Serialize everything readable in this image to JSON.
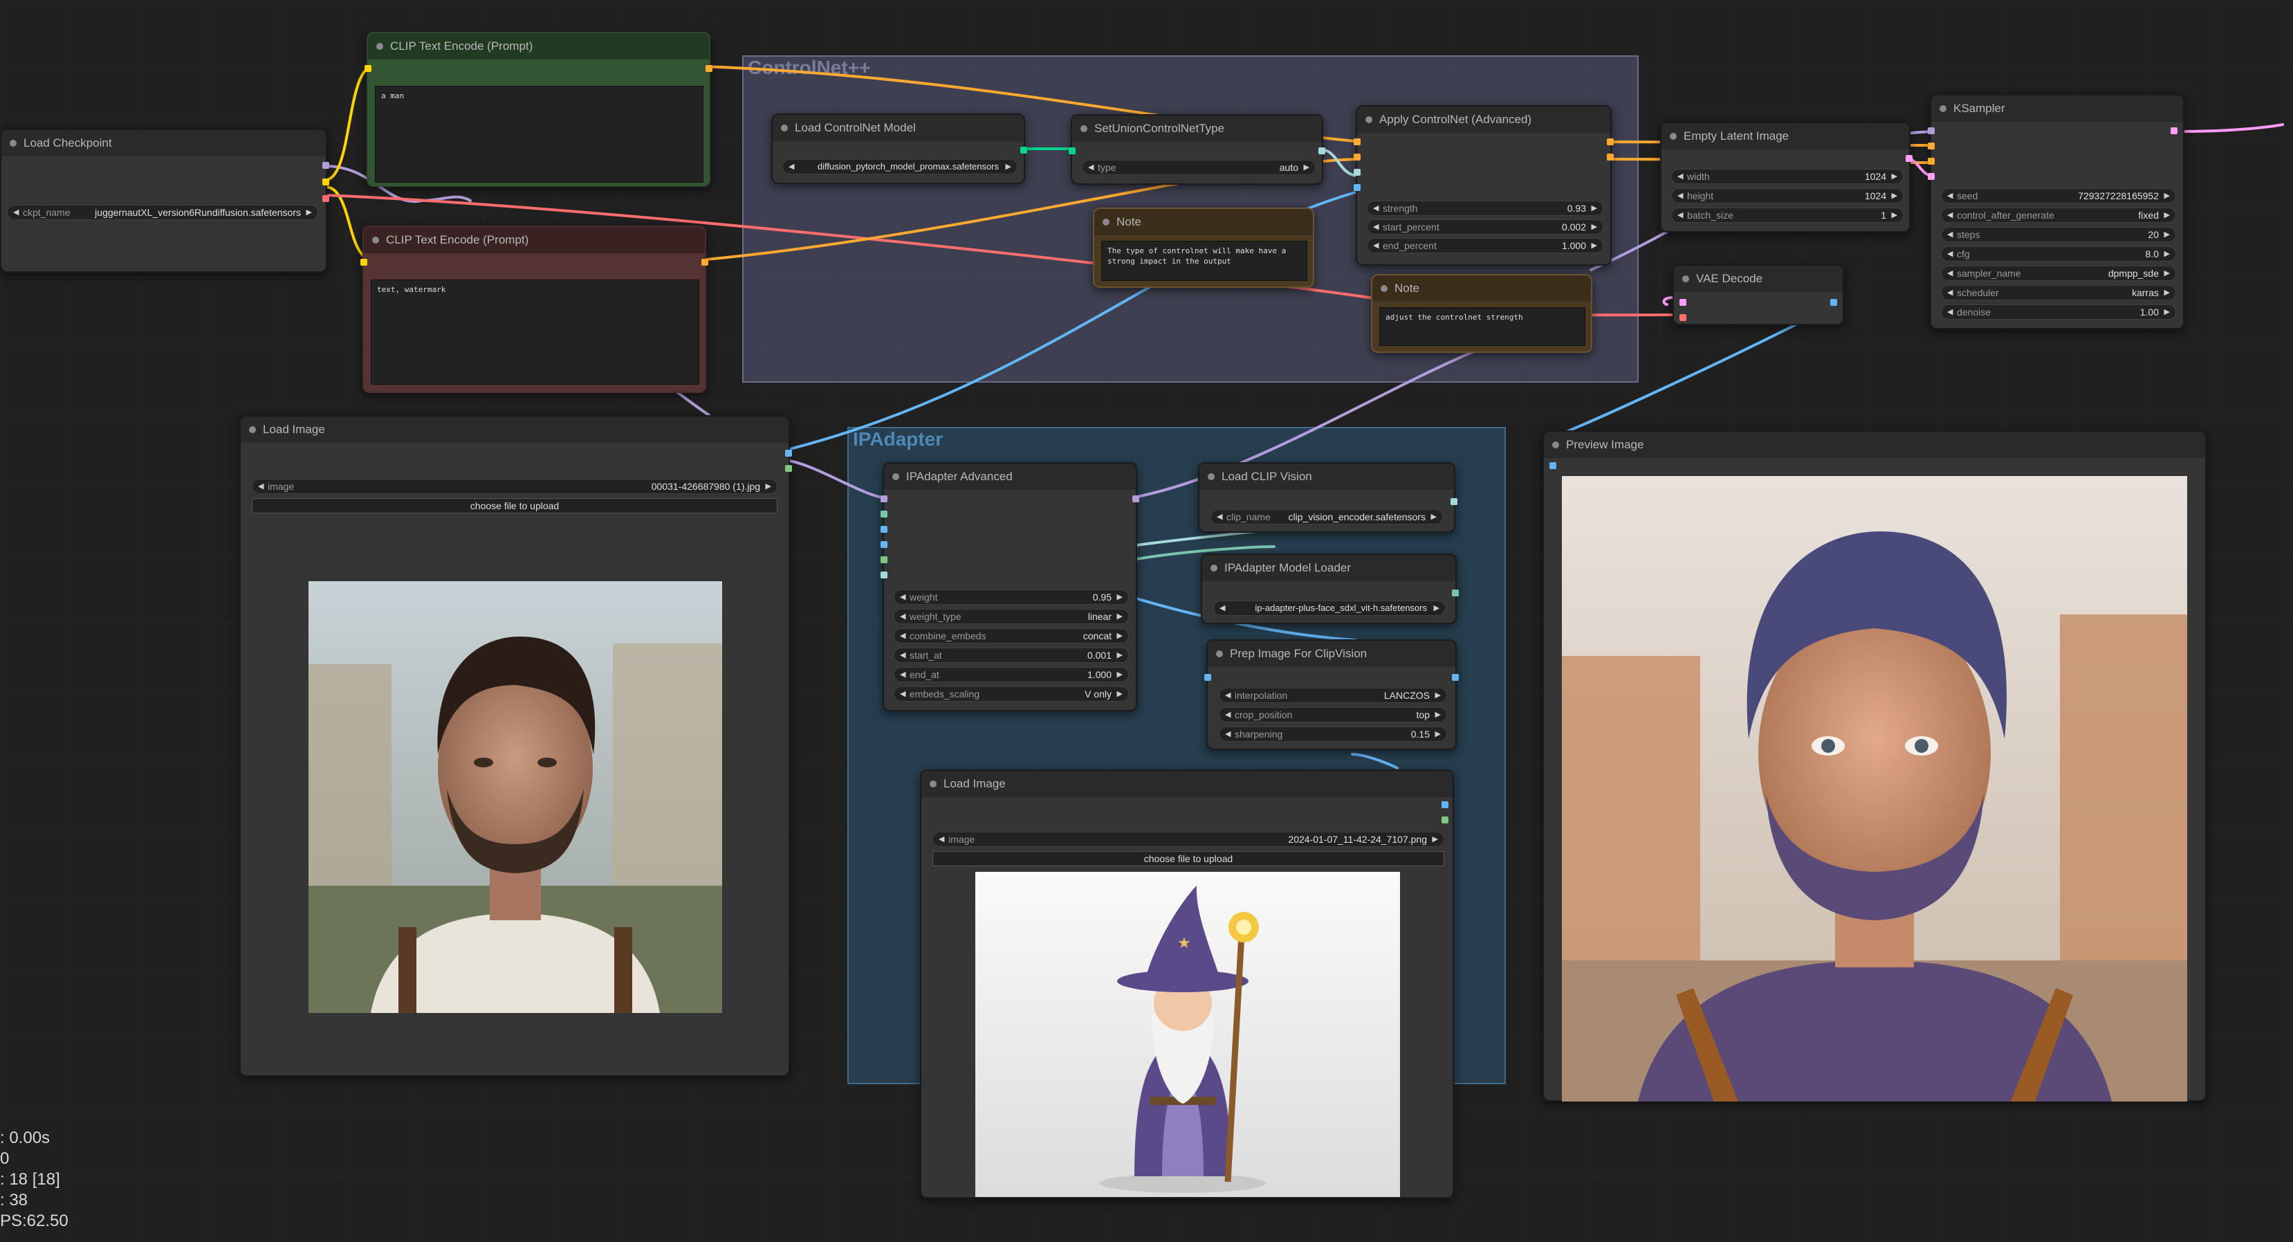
{
  "groups": {
    "controlnet": {
      "title": "ControlNet++"
    },
    "ipadapter": {
      "title": "IPAdapter"
    }
  },
  "nodes": {
    "load_checkpoint": {
      "title": "Load Checkpoint",
      "ckpt_name": {
        "label": "ckpt_name",
        "value": "juggernautXL_version6Rundiffusion.safetensors"
      }
    },
    "clip_pos": {
      "title": "CLIP Text Encode (Prompt)",
      "text": "a man"
    },
    "clip_neg": {
      "title": "CLIP Text Encode (Prompt)",
      "text": "text, watermark"
    },
    "load_controlnet": {
      "title": "Load ControlNet Model",
      "control_net_name": {
        "label": "control_net_name",
        "value": "diffusion_pytorch_model_promax.safetensors"
      }
    },
    "set_union": {
      "title": "SetUnionControlNetType",
      "type": {
        "label": "type",
        "value": "auto"
      }
    },
    "apply_controlnet": {
      "title": "Apply ControlNet (Advanced)",
      "strength": {
        "label": "strength",
        "value": "0.93"
      },
      "start_percent": {
        "label": "start_percent",
        "value": "0.002"
      },
      "end_percent": {
        "label": "end_percent",
        "value": "1.000"
      }
    },
    "note1": {
      "title": "Note",
      "text": "The type of controlnet will make have a\nstrong impact in the output"
    },
    "note2": {
      "title": "Note",
      "text": "adjust the controlnet strength"
    },
    "empty_latent": {
      "title": "Empty Latent Image",
      "width": {
        "label": "width",
        "value": "1024"
      },
      "height": {
        "label": "height",
        "value": "1024"
      },
      "batch_size": {
        "label": "batch_size",
        "value": "1"
      }
    },
    "ksampler": {
      "title": "KSampler",
      "seed": {
        "label": "seed",
        "value": "729327228165952"
      },
      "control_after_generate": {
        "label": "control_after_generate",
        "value": "fixed"
      },
      "steps": {
        "label": "steps",
        "value": "20"
      },
      "cfg": {
        "label": "cfg",
        "value": "8.0"
      },
      "sampler_name": {
        "label": "sampler_name",
        "value": "dpmpp_sde"
      },
      "scheduler": {
        "label": "scheduler",
        "value": "karras"
      },
      "denoise": {
        "label": "denoise",
        "value": "1.00"
      }
    },
    "vae_decode": {
      "title": "VAE Decode"
    },
    "load_image1": {
      "title": "Load Image",
      "image": {
        "label": "image",
        "value": "00031-426687980 (1).jpg"
      },
      "upload": "choose file to upload"
    },
    "ipadapter_adv": {
      "title": "IPAdapter Advanced",
      "weight": {
        "label": "weight",
        "value": "0.95"
      },
      "weight_type": {
        "label": "weight_type",
        "value": "linear"
      },
      "combine_embeds": {
        "label": "combine_embeds",
        "value": "concat"
      },
      "start_at": {
        "label": "start_at",
        "value": "0.001"
      },
      "end_at": {
        "label": "end_at",
        "value": "1.000"
      },
      "embeds_scaling": {
        "label": "embeds_scaling",
        "value": "V only"
      }
    },
    "load_clip_vision": {
      "title": "Load CLIP Vision",
      "clip_name": {
        "label": "clip_name",
        "value": "clip_vision_encoder.safetensors"
      }
    },
    "ipadapter_loader": {
      "title": "IPAdapter Model Loader",
      "ipadapter_file": {
        "label": "ipadapter_file",
        "value": "ip-adapter-plus-face_sdxl_vit-h.safetensors"
      }
    },
    "prep_image": {
      "title": "Prep Image For ClipVision",
      "interpolation": {
        "label": "interpolation",
        "value": "LANCZOS"
      },
      "crop_position": {
        "label": "crop_position",
        "value": "top"
      },
      "sharpening": {
        "label": "sharpening",
        "value": "0.15"
      }
    },
    "load_image2": {
      "title": "Load Image",
      "image": {
        "label": "image",
        "value": "2024-01-07_11-42-24_7107.png"
      },
      "upload": "choose file to upload"
    },
    "preview_image": {
      "title": "Preview Image"
    }
  },
  "stats": [
    ": 0.00s",
    " 0",
    ": 18 [18]",
    ": 38",
    "PS:62.50"
  ],
  "colors": {
    "model": "#b39ddb",
    "clip": "#ffd500",
    "conditioning": "#ffa931",
    "latent": "#ff9cf9",
    "vae": "#ff6e6e",
    "image": "#64b5f6",
    "control_net": "#00d78d",
    "clip_vision": "#a8dadc",
    "ipadapter": "#7bc5ae"
  }
}
